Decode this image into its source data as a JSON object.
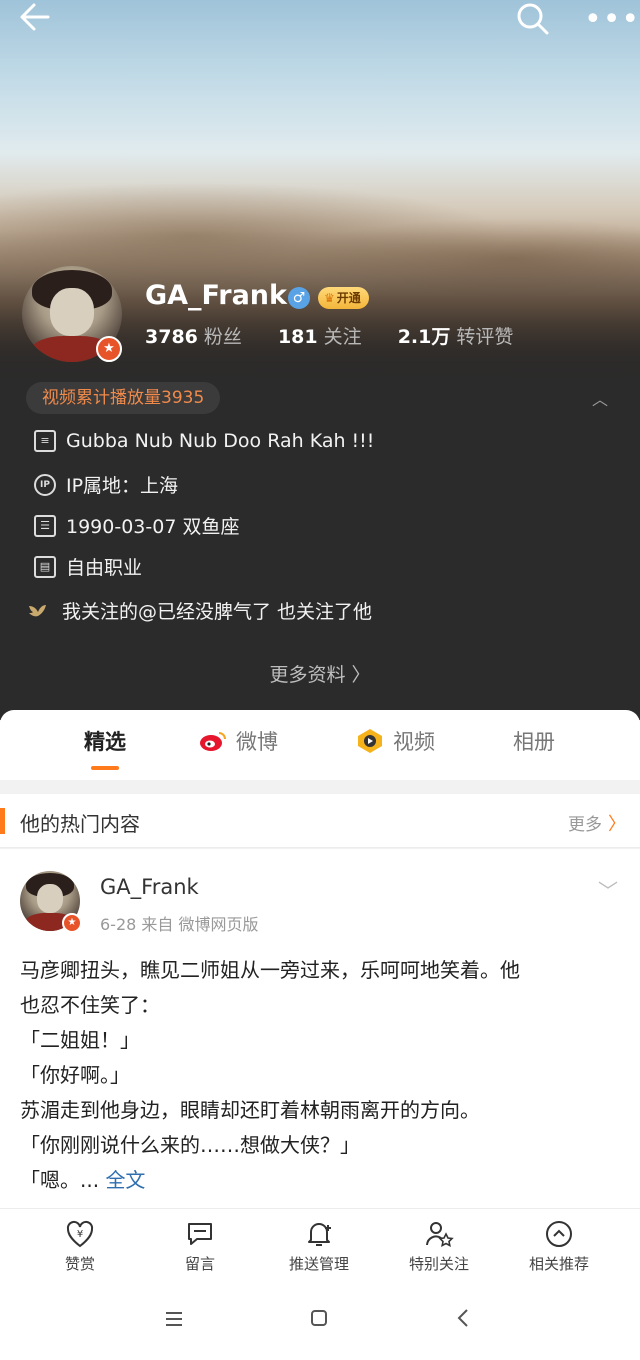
{
  "header": {
    "username": "GA_Frank",
    "vip_label": "开通",
    "stats": [
      {
        "num": "3786",
        "label": "粉丝"
      },
      {
        "num": "181",
        "label": "关注"
      },
      {
        "num": "2.1万",
        "label": "转评赞"
      }
    ],
    "plays": "视频累计播放量3935"
  },
  "info": {
    "bio": "Gubba Nub Nub Doo Rah Kah !!!",
    "ip": "IP属地：上海",
    "birthday": "1990-03-07 双鱼座",
    "job": "自由职业",
    "mutual": "我关注的@已经没脾气了 也关注了他",
    "more": "更多资料 〉"
  },
  "tabs": [
    "精选",
    "微博",
    "视频",
    "相册"
  ],
  "hot": {
    "title": "他的热门内容",
    "more": "更多"
  },
  "post": {
    "author": "GA_Frank",
    "meta": "6-28   来自 微博网页版",
    "lines": [
      "马彦卿扭头，瞧见二师姐从一旁过来，乐呵呵地笑着。他",
      "也忍不住笑了：",
      "「二姐姐！」",
      "「你好啊。」",
      "苏湄走到他身边，眼睛却还盯着林朝雨离开的方向。",
      "「你刚刚说什么来的……想做大侠？」"
    ],
    "last_line": "「嗯。... ",
    "full_text": "全文"
  },
  "actions": [
    "赞赏",
    "留言",
    "推送管理",
    "特别关注",
    "相关推荐"
  ],
  "colors": {
    "accent": "#ff7a1a",
    "plays_text": "#f08a4b",
    "link": "#2f6fb0",
    "dark_bg": "#2b2b2b"
  }
}
